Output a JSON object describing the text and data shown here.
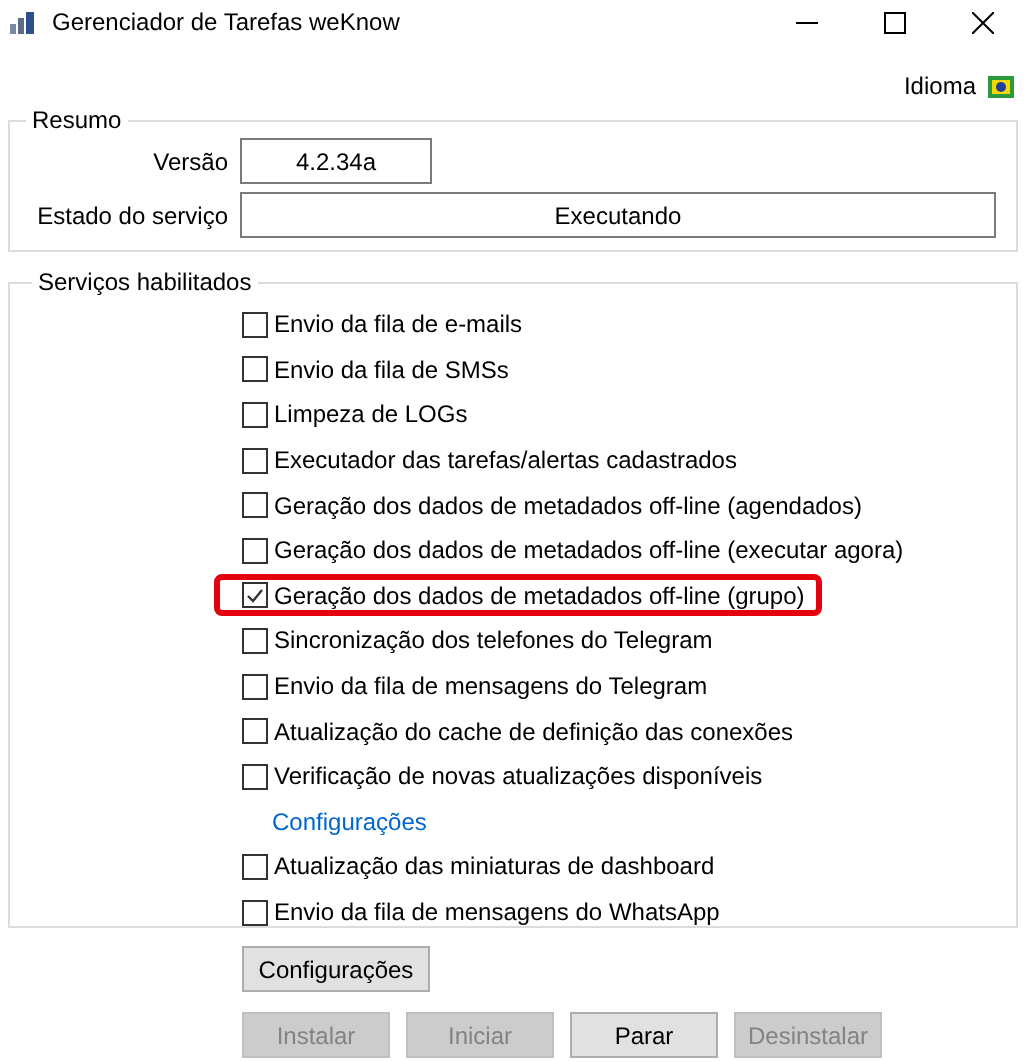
{
  "window": {
    "title": "Gerenciador de Tarefas weKnow"
  },
  "language": {
    "label": "Idioma"
  },
  "summary": {
    "title": "Resumo",
    "fields": [
      {
        "label": "Versão",
        "value": "4.2.34a",
        "kind": "short"
      },
      {
        "label": "Estado do serviço",
        "value": "Executando",
        "kind": "wide"
      }
    ]
  },
  "services": {
    "title": "Serviços habilitados",
    "items": [
      {
        "kind": "checkbox",
        "label": "Envio da fila de e-mails",
        "checked": false,
        "highlighted": false
      },
      {
        "kind": "checkbox",
        "label": "Envio da fila de SMSs",
        "checked": false,
        "highlighted": false
      },
      {
        "kind": "checkbox",
        "label": "Limpeza de LOGs",
        "checked": false,
        "highlighted": false
      },
      {
        "kind": "checkbox",
        "label": "Executador das tarefas/alertas cadastrados",
        "checked": false,
        "highlighted": false
      },
      {
        "kind": "checkbox",
        "label": "Geração dos dados de metadados off-line (agendados)",
        "checked": false,
        "highlighted": false
      },
      {
        "kind": "checkbox",
        "label": "Geração dos dados de metadados off-line (executar agora)",
        "checked": false,
        "highlighted": false
      },
      {
        "kind": "checkbox",
        "label": "Geração dos dados de metadados off-line (grupo)",
        "checked": true,
        "highlighted": true
      },
      {
        "kind": "checkbox",
        "label": "Sincronização dos telefones do Telegram",
        "checked": false,
        "highlighted": false
      },
      {
        "kind": "checkbox",
        "label": "Envio da fila de mensagens do Telegram",
        "checked": false,
        "highlighted": false
      },
      {
        "kind": "checkbox",
        "label": "Atualização do cache de definição das conexões",
        "checked": false,
        "highlighted": false
      },
      {
        "kind": "checkbox",
        "label": "Verificação de novas atualizações disponíveis",
        "checked": false,
        "highlighted": false
      },
      {
        "kind": "link",
        "label": "Configurações"
      },
      {
        "kind": "checkbox",
        "label": "Atualização das miniaturas de dashboard",
        "checked": false,
        "highlighted": false
      },
      {
        "kind": "checkbox",
        "label": "Envio da fila de mensagens do WhatsApp",
        "checked": false,
        "highlighted": false
      }
    ]
  },
  "settings_button": {
    "label": "Configurações"
  },
  "actions": [
    {
      "label": "Instalar",
      "disabled": true
    },
    {
      "label": "Iniciar",
      "disabled": true
    },
    {
      "label": "Parar",
      "disabled": false
    },
    {
      "label": "Desinstalar",
      "disabled": true
    }
  ]
}
